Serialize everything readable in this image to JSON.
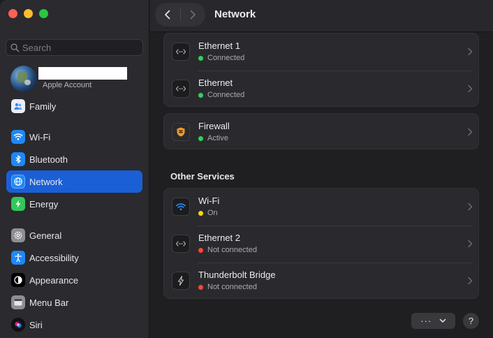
{
  "window": {
    "title": "Network"
  },
  "search": {
    "placeholder": "Search"
  },
  "account": {
    "sub": "Apple Account"
  },
  "sidebar": {
    "items": [
      {
        "label": "Family",
        "icon": "family-icon"
      },
      {
        "label": "Wi-Fi",
        "icon": "wifi-icon"
      },
      {
        "label": "Bluetooth",
        "icon": "bluetooth-icon"
      },
      {
        "label": "Network",
        "icon": "network-globe-icon",
        "active": true
      },
      {
        "label": "Energy",
        "icon": "energy-icon"
      },
      {
        "label": "General",
        "icon": "gear-icon"
      },
      {
        "label": "Accessibility",
        "icon": "accessibility-icon"
      },
      {
        "label": "Appearance",
        "icon": "appearance-icon"
      },
      {
        "label": "Menu Bar",
        "icon": "menu-bar-icon"
      },
      {
        "label": "Siri",
        "icon": "siri-icon"
      }
    ]
  },
  "services": [
    {
      "name": "Ethernet 1",
      "status": "Connected",
      "status_color": "#30d158",
      "icon": "ethernet-icon"
    },
    {
      "name": "Ethernet",
      "status": "Connected",
      "status_color": "#30d158",
      "icon": "ethernet-icon"
    }
  ],
  "firewall": {
    "name": "Firewall",
    "status": "Active",
    "status_color": "#30d158",
    "icon": "firewall-icon"
  },
  "other": {
    "title": "Other Services",
    "items": [
      {
        "name": "Wi-Fi",
        "status": "On",
        "status_color": "#ffd60a",
        "icon": "wifi-icon"
      },
      {
        "name": "Ethernet 2",
        "status": "Not connected",
        "status_color": "#ff453a",
        "icon": "ethernet-icon"
      },
      {
        "name": "Thunderbolt Bridge",
        "status": "Not connected",
        "status_color": "#ff453a",
        "icon": "thunderbolt-icon"
      }
    ]
  },
  "footer": {
    "more": "···",
    "help": "?"
  },
  "colors": {
    "accent": "#1b5fd6",
    "green": "#30d158",
    "yellow": "#ffd60a",
    "red": "#ff453a"
  }
}
